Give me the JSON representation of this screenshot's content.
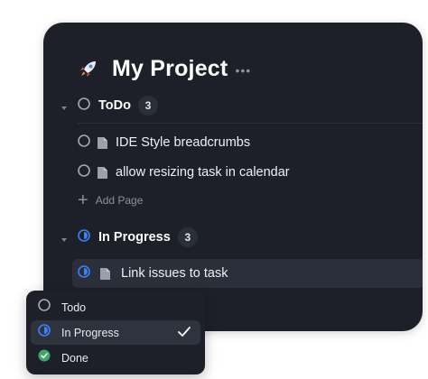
{
  "project": {
    "title": "My Project",
    "icon": "rocket-icon",
    "more_label": "•••"
  },
  "groups": [
    {
      "name": "ToDo",
      "count": "3",
      "status_icon": "status-todo-icon",
      "tasks": [
        {
          "title": "IDE Style breadcrumbs"
        },
        {
          "title": "allow resizing task in calendar"
        }
      ],
      "add_page_label": "Add Page"
    },
    {
      "name": "In Progress",
      "count": "3",
      "status_icon": "status-in-progress-icon",
      "tasks": [
        {
          "title": "Link issues to task"
        }
      ]
    }
  ],
  "status_menu": {
    "options": [
      {
        "label": "Todo",
        "icon": "status-todo-icon",
        "selected": false
      },
      {
        "label": "In Progress",
        "icon": "status-in-progress-icon",
        "selected": true
      },
      {
        "label": "Done",
        "icon": "status-done-icon",
        "selected": false
      }
    ]
  },
  "colors": {
    "panel_bg": "#1d2028",
    "accent_blue": "#3b82f6",
    "done_green": "#3fa66b",
    "text_primary": "#ffffff",
    "text_muted": "#8b90a0"
  }
}
